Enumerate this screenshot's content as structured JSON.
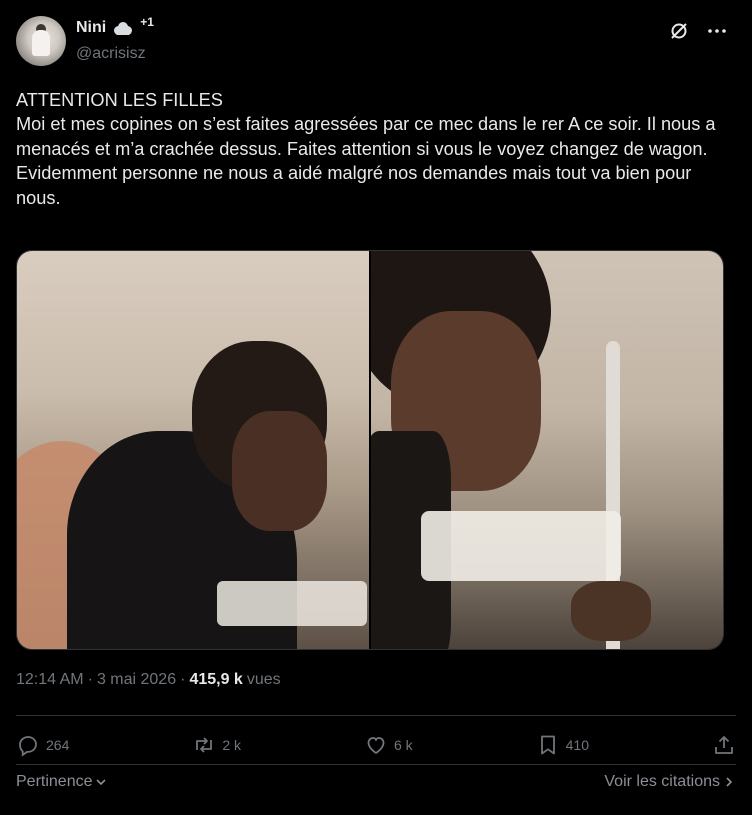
{
  "author": {
    "name": "Nini",
    "badge": "+1",
    "handle": "@acrisisz",
    "avatar_icon": "profile-photo",
    "name_emoji_icon": "cloud-icon"
  },
  "header_icons": [
    "grok-icon",
    "more-icon"
  ],
  "tweet": {
    "text": "ATTENTION LES FILLES\nMoi et mes copines on s’est faites agressées par ce mec dans le rer A ce soir. Il nous a menacés et m’a crachée dessus. Faites attention si vous le voyez changez de wagon. Evidemment personne ne nous a aidé malgré nos demandes mais tout va bien pour nous."
  },
  "media": {
    "count": 2,
    "photos": [
      "photo-1",
      "photo-2"
    ]
  },
  "meta": {
    "time": "12:14 AM",
    "separator1": "·",
    "date": "3 mai 2026",
    "separator2": "·",
    "views_count": "415,9 k",
    "views_label": "vues"
  },
  "actions": {
    "reply_count": "264",
    "retweet_count": "2 k",
    "like_count": "6 k",
    "bookmark_count": "410"
  },
  "footer": {
    "sort_label": "Pertinence",
    "quotes_link": "Voir les citations"
  },
  "colors": {
    "background": "#000000",
    "text": "#e7e9ea",
    "secondary": "#71767b",
    "border": "#2f3336"
  }
}
